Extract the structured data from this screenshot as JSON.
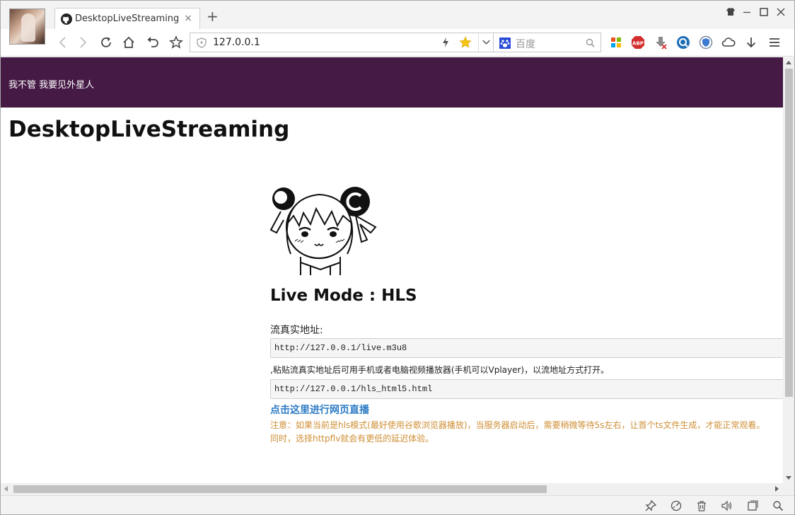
{
  "browser": {
    "tab": {
      "title": "DesktopLiveStreaming",
      "close": "×"
    },
    "new_tab": "+",
    "address": {
      "url": "127.0.0.1"
    },
    "search": {
      "placeholder": "百度"
    }
  },
  "page": {
    "banner_text": "我不管 我要见外星人",
    "title": "DesktopLiveStreaming",
    "mode": "Live Mode : HLS",
    "stream_label": "流真实地址:",
    "stream_url": "http://127.0.0.1/live.m3u8",
    "hint": ",粘贴流真实地址后可用手机或者电脑视频播放器(手机可以Vplayer)，以流地址方式打开。",
    "html5_url": "http://127.0.0.1/hls_html5.html",
    "live_link": "点击这里进行网页直播",
    "note_line1": "注意：如果当前是hls模式(最好使用谷歌浏览器播放)，当服务器启动后，需要稍微等待5s左右，让首个ts文件生成，才能正常观看。",
    "note_line2": "同时，选择httpflv就会有更低的延迟体验。"
  },
  "colors": {
    "banner": "#451a45",
    "link": "#2d7cc5",
    "note": "#cf8f35"
  },
  "icons": {
    "tab_favicon": "github-icon",
    "toolbar": [
      "back-icon",
      "forward-icon",
      "reload-icon",
      "home-icon",
      "undo-icon",
      "bookmark-star-icon"
    ],
    "extensions": [
      "apps-grid-icon",
      "adblock-icon",
      "download-manager-icon",
      "search-ext-icon",
      "shield-ext-icon",
      "cloud-icon",
      "download-icon",
      "menu-icon"
    ],
    "status": [
      "pin-icon",
      "speed-icon",
      "trash-icon",
      "sound-icon",
      "window-icon",
      "zoom-icon"
    ]
  }
}
